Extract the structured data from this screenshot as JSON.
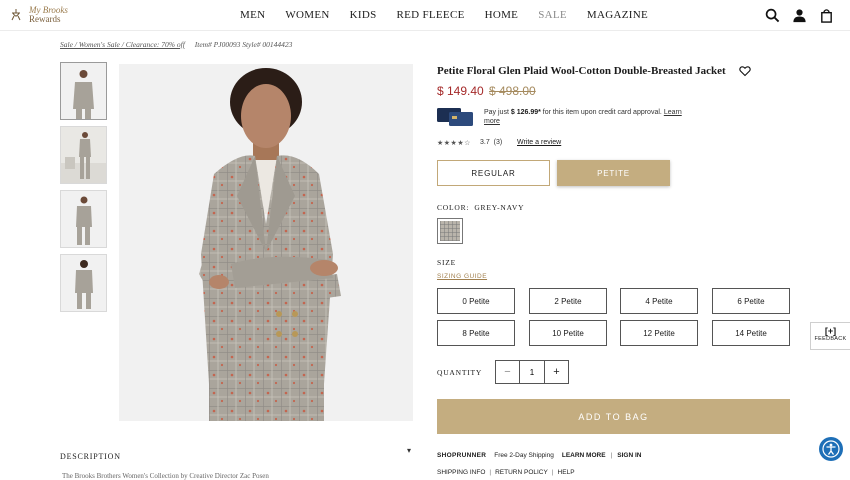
{
  "brand": {
    "logo_text_line1": "My Brooks",
    "logo_text_line2": "Rewards"
  },
  "nav": {
    "items": [
      {
        "label": "MEN"
      },
      {
        "label": "WOMEN"
      },
      {
        "label": "KIDS"
      },
      {
        "label": "RED FLEECE"
      },
      {
        "label": "HOME"
      },
      {
        "label": "SALE"
      },
      {
        "label": "MAGAZINE"
      }
    ]
  },
  "breadcrumb": {
    "path": "Sale / Women's Sale / Clearance: 70% off",
    "item": "Item# PJ00093 Style# 00144423"
  },
  "product": {
    "title": "Petite Floral Glen Plaid Wool-Cotton Double-Breasted Jacket",
    "price_now": "$ 149.40",
    "price_was": "$ 498.00",
    "credit_pre": "Pay just ",
    "credit_amount": "$ 126.99*",
    "credit_post": " for this item upon credit card approval.",
    "credit_link": "Learn more",
    "stars": "★★★★☆",
    "rating": "3.7",
    "review_count": "(3)",
    "review_link": "Write a review"
  },
  "fit": {
    "regular": "REGULAR",
    "petite": "PETITE",
    "selected": "PETITE"
  },
  "color": {
    "label": "COLOR:",
    "value": "GREY-NAVY"
  },
  "size": {
    "label": "SIZE",
    "guide": "SIZING GUIDE",
    "options": [
      "0 Petite",
      "2 Petite",
      "4 Petite",
      "6 Petite",
      "8 Petite",
      "10 Petite",
      "12 Petite",
      "14 Petite"
    ]
  },
  "quantity": {
    "label": "QUANTITY",
    "minus": "−",
    "value": "1",
    "plus": "+"
  },
  "cta": {
    "add_to_bag": "ADD TO BAG"
  },
  "shoprunner": {
    "logo": "SHOPRUNNER",
    "text": "Free 2-Day Shipping",
    "learn_more": "LEARN MORE",
    "separator": "|",
    "sign_in": "SIGN IN"
  },
  "footer": {
    "shipping": "SHIPPING INFO",
    "returns": "RETURN POLICY",
    "help": "HELP",
    "separator": "|"
  },
  "description": {
    "title": "DESCRIPTION",
    "caret": "▾",
    "preview": "The Brooks Brothers Women's Collection by Creative Director Zac Posen"
  },
  "feedback": {
    "symbol": "[+]",
    "label": "FEEDBACK"
  },
  "colors": {
    "accent_gold": "#c4ad80",
    "sale_red": "#a52a2a",
    "accessibility_blue": "#1e6fb7"
  },
  "icons": [
    "search-icon",
    "account-icon",
    "bag-icon",
    "heart-icon",
    "accessibility-icon"
  ]
}
